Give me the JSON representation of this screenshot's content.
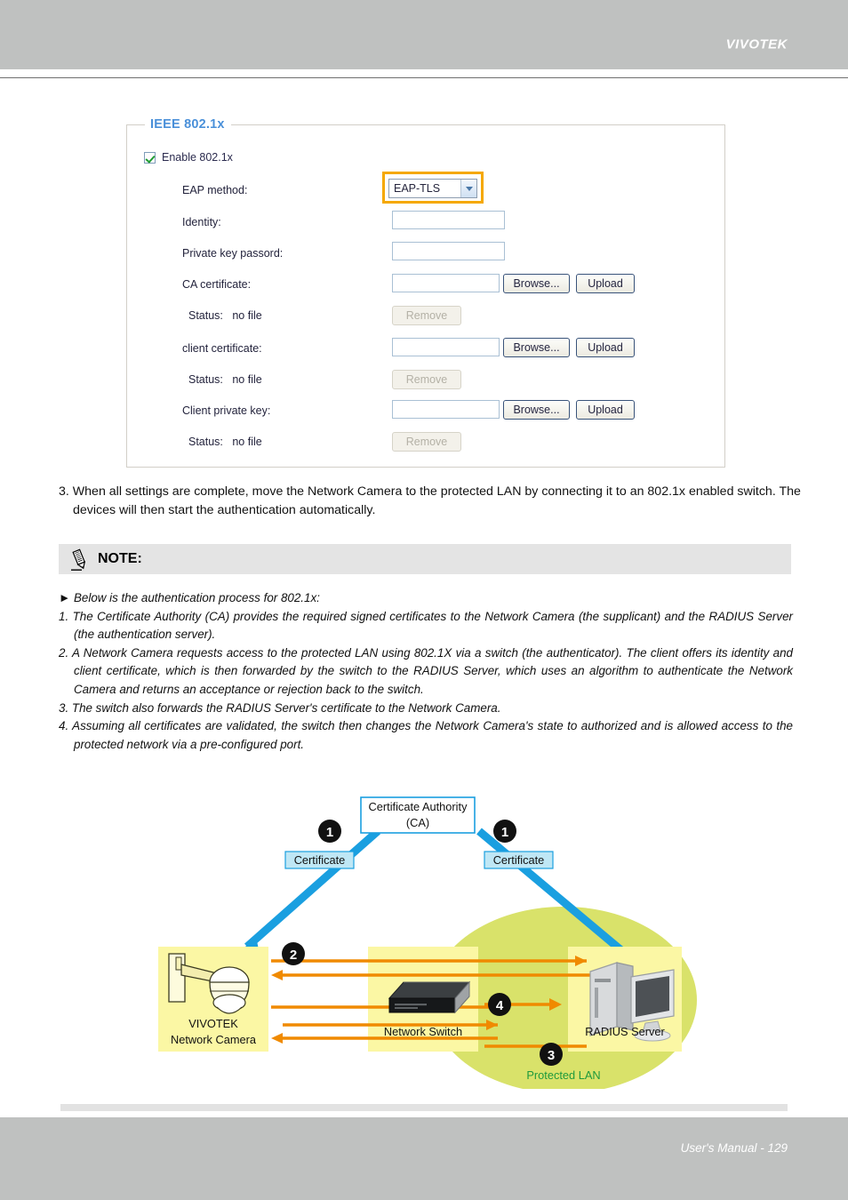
{
  "header": {
    "brand": "VIVOTEK"
  },
  "form": {
    "legend": "IEEE 802.1x",
    "enable": {
      "label": "Enable 802.1x",
      "checked": true
    },
    "eap_method": {
      "label": "EAP method:",
      "value": "EAP-TLS",
      "highlight_color": "#f5a800"
    },
    "identity": {
      "label": "Identity:",
      "value": ""
    },
    "private_key_password": {
      "label": "Private key passord:",
      "value": ""
    },
    "ca_certificate": {
      "label": "CA certificate:",
      "value": "",
      "browse_label": "Browse...",
      "upload_label": "Upload",
      "status_label": "Status:",
      "status_value": "no file",
      "remove_label": "Remove"
    },
    "client_certificate": {
      "label": "client certificate:",
      "value": "",
      "browse_label": "Browse...",
      "upload_label": "Upload",
      "status_label": "Status:",
      "status_value": "no file",
      "remove_label": "Remove"
    },
    "client_private_key": {
      "label": "Client private key:",
      "value": "",
      "browse_label": "Browse...",
      "upload_label": "Upload",
      "status_label": "Status:",
      "status_value": "no file",
      "remove_label": "Remove"
    }
  },
  "body": {
    "step3": "3. When all settings are complete, move the Network Camera to the protected LAN by connecting it to an 802.1x enabled switch. The devices will then start the authentication automatically."
  },
  "note": {
    "title": "NOTE:",
    "icon": "pencil-icon",
    "lines": [
      "► Below is the authentication process for 802.1x:",
      "1. The Certificate Authority (CA) provides the required signed certificates to the Network Camera (the supplicant) and the RADIUS Server (the authentication server).",
      "2. A Network Camera requests access to the protected LAN using 802.1X via a switch (the authenticator). The client offers its identity and client certificate, which is then forwarded by the switch to the RADIUS Server, which uses an algorithm to authenticate the Network Camera and returns an acceptance or rejection back to the switch.",
      "3. The switch also forwards the RADIUS Server's certificate to the Network Camera.",
      "4. Assuming all certificates are validated, the switch then changes the Network Camera's state to authorized and is allowed access to the protected network via a pre-configured port."
    ]
  },
  "diagram": {
    "ca_box": {
      "line1": "Certificate Authority",
      "line2": "(CA)"
    },
    "cert_label_left": "Certificate",
    "cert_label_right": "Certificate",
    "badges": [
      "1",
      "1",
      "2",
      "3",
      "4"
    ],
    "camera": {
      "line1": "VIVOTEK",
      "line2": "Network Camera"
    },
    "switch_label": "Network Switch",
    "radius_label": "RADIUS Server",
    "protected_lan_label": "Protected LAN",
    "colors": {
      "arrow_blue": "#1a9fe0",
      "arrow_orange": "#f08a00",
      "device_box": "#fbf7a4",
      "lan_ellipse": "#d9e26a",
      "lan_text": "#1f9a3c",
      "cert_label_fill": "#bfe7f5"
    }
  },
  "footer": {
    "text": "User's Manual - 129"
  }
}
